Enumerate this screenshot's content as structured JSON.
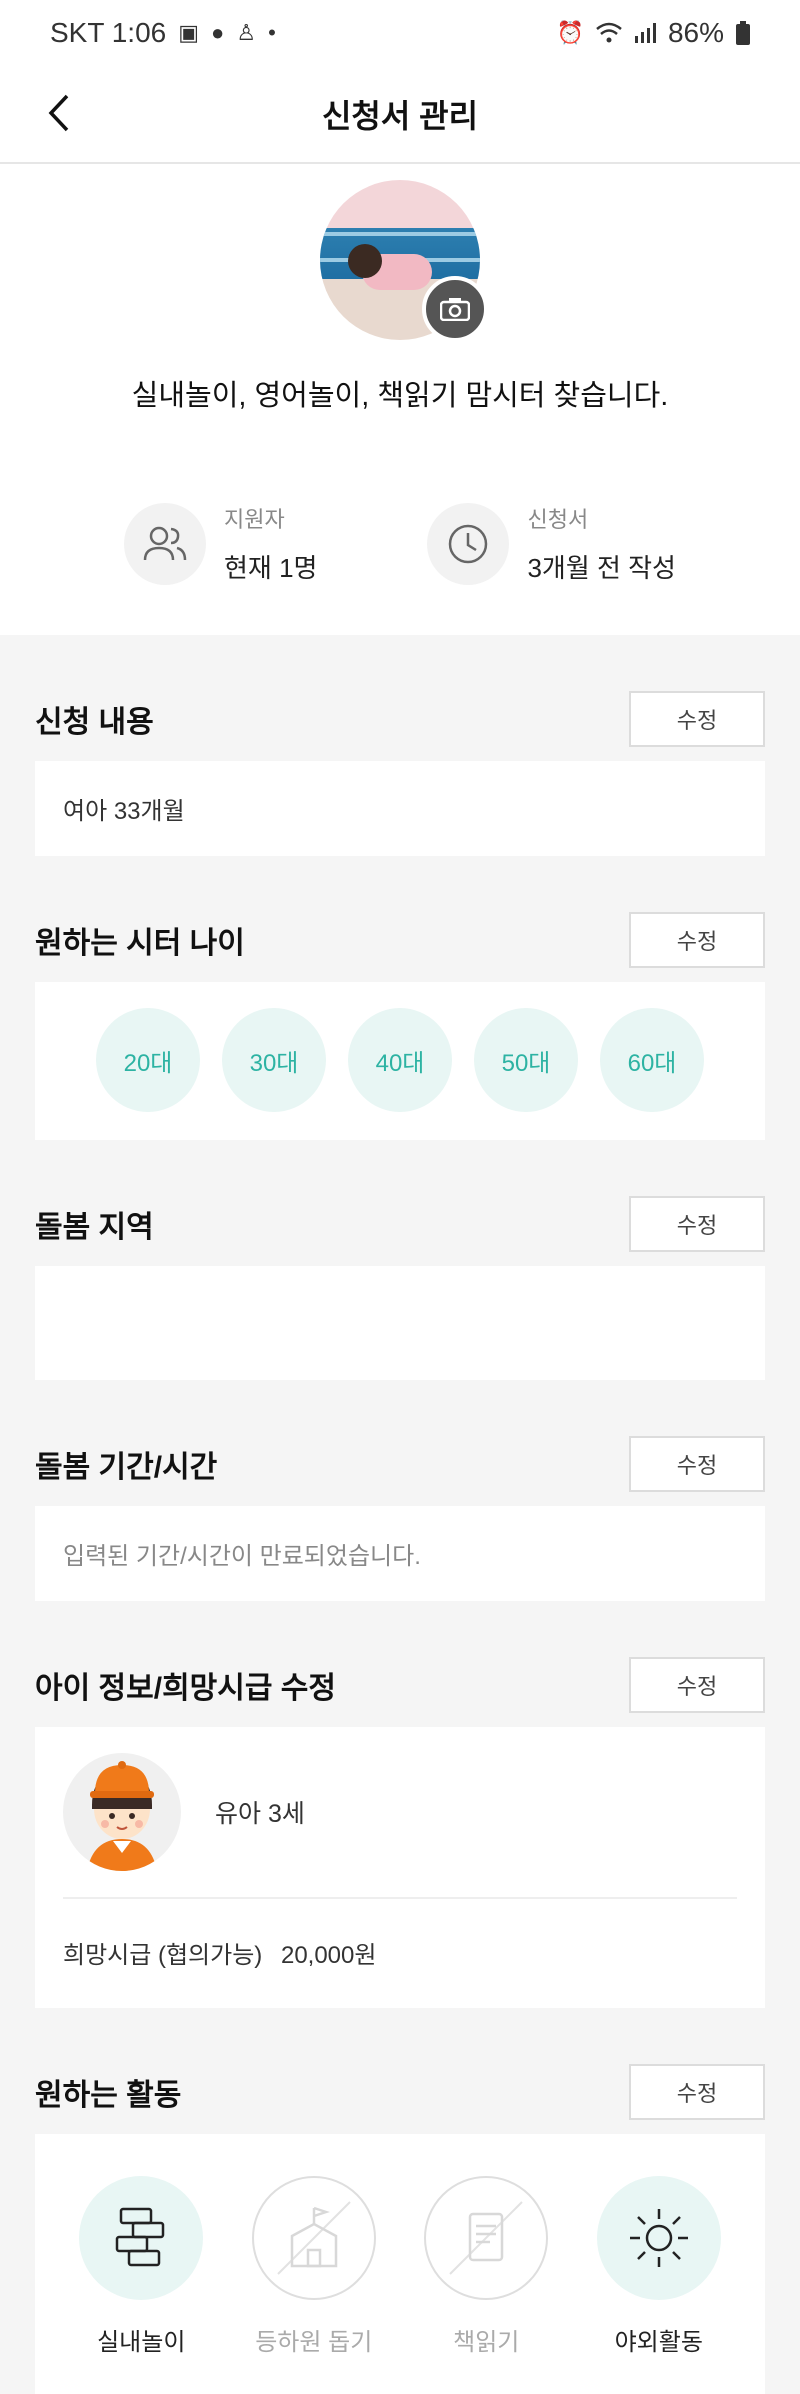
{
  "status_bar": {
    "carrier_time": "SKT 1:06",
    "battery": "86%"
  },
  "header": {
    "title": "신청서 관리"
  },
  "profile": {
    "title": "실내놀이, 영어놀이, 책읽기 맘시터 찾습니다."
  },
  "stats": {
    "applicants_label": "지원자",
    "applicants_value": "현재 1명",
    "application_label": "신청서",
    "application_value": "3개월 전 작성"
  },
  "edit_label": "수정",
  "sections": {
    "request": {
      "title": "신청 내용",
      "content": "여아 33개월"
    },
    "age": {
      "title": "원하는 시터 나이",
      "options": [
        "20대",
        "30대",
        "40대",
        "50대",
        "60대"
      ]
    },
    "region": {
      "title": "돌봄 지역",
      "content": ""
    },
    "period": {
      "title": "돌봄 기간/시간",
      "content": "입력된 기간/시간이 만료되었습니다."
    },
    "child": {
      "title": "아이 정보/희망시급 수정",
      "child_label": "유아 3세",
      "wage_label": "희망시급 (협의가능)",
      "wage_value": "20,000원"
    },
    "activities": {
      "title": "원하는 활동",
      "items": [
        {
          "label": "실내놀이",
          "active": true,
          "icon": "blocks-icon"
        },
        {
          "label": "등하원 돕기",
          "active": false,
          "icon": "school-icon"
        },
        {
          "label": "책읽기",
          "active": false,
          "icon": "book-icon"
        },
        {
          "label": "야외활동",
          "active": true,
          "icon": "sun-icon"
        }
      ]
    }
  },
  "colors": {
    "accent": "#2db3a3",
    "accent_bg": "#e8f6f4",
    "page_bg": "#f5f5f5"
  }
}
